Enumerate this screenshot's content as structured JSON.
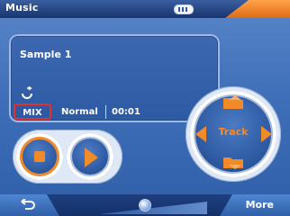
{
  "app": {
    "title": "Music"
  },
  "status": {
    "battery_icon": "battery-icon"
  },
  "track": {
    "name": "Sample 1",
    "shuffle_mode": "MIX",
    "play_mode": "Normal",
    "time": "00:01",
    "repeat_icon": "repeat-icon"
  },
  "controls": {
    "stop_icon": "stop-icon",
    "play_icon": "play-icon",
    "track_label": "Track",
    "prev_icon": "left-arrow-icon",
    "next_icon": "right-arrow-icon",
    "folder_up_icon": "folder-up-icon",
    "folder_down_icon": "folder-down-icon"
  },
  "bottom": {
    "back_icon": "back-icon",
    "more_label": "More",
    "volume_slider_icon": "volume-slider"
  },
  "colors": {
    "accent": "#f28a2a",
    "primary": "#2f5fa8",
    "highlight_border": "#e2322f"
  }
}
